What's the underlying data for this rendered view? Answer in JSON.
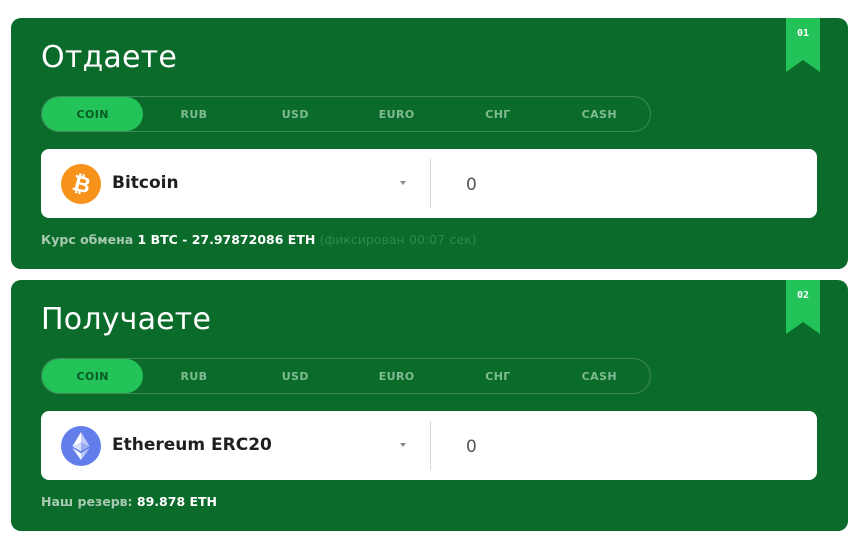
{
  "give": {
    "title": "Отдаете",
    "step": "01",
    "tabs": [
      "COIN",
      "RUB",
      "USD",
      "EURO",
      "СНГ",
      "CASH"
    ],
    "active_tab": "COIN",
    "currency": {
      "name": "Bitcoin",
      "icon": "bitcoin-icon",
      "color": "#f7931a"
    },
    "amount": {
      "placeholder": "0"
    },
    "rate": {
      "label": "Курс обмена",
      "value": "1 BTC - 27.97872086 ETH",
      "fixed_prefix": "(фиксирован",
      "timer": "00:07",
      "timer_unit": "сек)"
    }
  },
  "get": {
    "title": "Получаете",
    "step": "02",
    "tabs": [
      "COIN",
      "RUB",
      "USD",
      "EURO",
      "СНГ",
      "CASH"
    ],
    "active_tab": "COIN",
    "currency": {
      "name": "Ethereum ERC20",
      "icon": "ethereum-icon",
      "color": "#627eea"
    },
    "amount": {
      "placeholder": "0"
    },
    "reserve": {
      "label": "Наш резерв:",
      "value": "89.878 ETH"
    }
  },
  "colors": {
    "panel": "#0a6b2a",
    "accent": "#23c35a",
    "tab_inactive": "#7fbc92"
  }
}
